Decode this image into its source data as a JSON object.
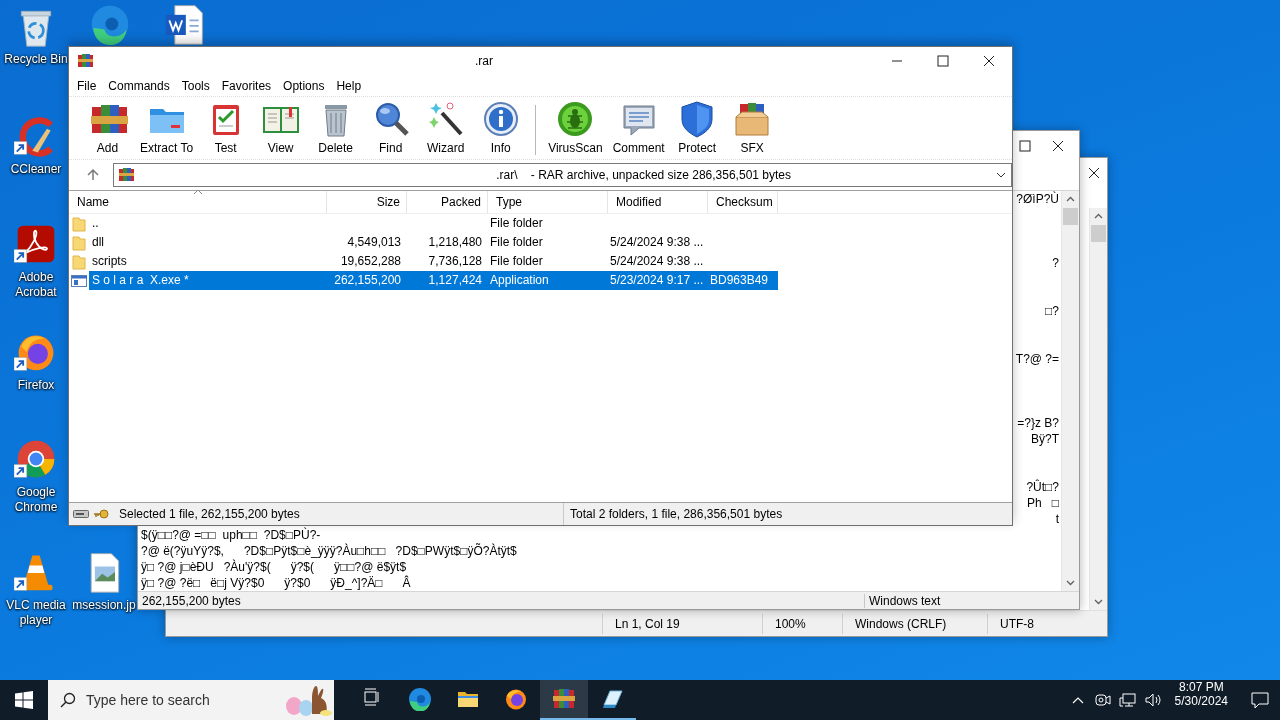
{
  "desktop_icons": [
    {
      "kind": "recycle",
      "label": "Recycle Bin",
      "shortcut": false
    },
    {
      "kind": "edge",
      "shortcut": false
    },
    {
      "kind": "word",
      "shortcut": false
    },
    {
      "kind": "ccleaner",
      "label": "CCleaner",
      "shortcut": true
    },
    {
      "kind": "acrobat",
      "label": "Adobe Acrobat",
      "shortcut": true
    },
    {
      "kind": "firefox",
      "label": "Firefox",
      "shortcut": true
    },
    {
      "kind": "chrome",
      "label": "Google Chrome",
      "shortcut": true
    },
    {
      "kind": "vlc",
      "label": "VLC media player",
      "shortcut": true
    },
    {
      "kind": "image",
      "label": "msession.jp",
      "shortcut": false
    }
  ],
  "notepad_window": {
    "status_bar": [
      "Ln 1, Col 19",
      "100%",
      "Windows (CRLF)",
      "UTF-8"
    ]
  },
  "viewer_window": {
    "lines": [
      {
        "kind": "tail",
        "text": "?ØìP?Ù"
      },
      {
        "kind": "blank"
      },
      {
        "kind": "blank"
      },
      {
        "kind": "blank"
      },
      {
        "kind": "tail",
        "text": "?"
      },
      {
        "kind": "blank"
      },
      {
        "kind": "blank"
      },
      {
        "kind": "tail",
        "text": "□?"
      },
      {
        "kind": "blank"
      },
      {
        "kind": "blank"
      },
      {
        "kind": "tail",
        "text": "T?@ ?="
      },
      {
        "kind": "blank"
      },
      {
        "kind": "blank"
      },
      {
        "kind": "blank"
      },
      {
        "kind": "tail",
        "text": "=?}z B?"
      },
      {
        "kind": "tail",
        "text": "Bÿ?T"
      },
      {
        "kind": "blank"
      },
      {
        "kind": "blank"
      },
      {
        "kind": "tail",
        "text": "?Ût□?"
      },
      {
        "kind": "tail",
        "text": "Ph   □"
      },
      {
        "kind": "tail",
        "text": "t"
      },
      {
        "kind": "full",
        "text": "$(ÿ□□?@ =□□  uph□□  ?D$□PÙ?-"
      },
      {
        "kind": "full",
        "text": "?@ ë(?ÿuYÿ?$,      ?D$□Pÿt$□è_ÿÿÿ?Àu□h□□   ?D$□PWÿt$□ÿÕ?Àtÿt$"
      },
      {
        "kind": "full",
        "text": "ÿ□ ?@ j□èÐU   ?Àu'ÿ?$(      ÿ?$(      ÿ□□?@ ë$ÿt$"
      },
      {
        "kind": "full",
        "text": "ÿ□ ?@ ?ë□   ë□j Vÿ?$0      ÿ?$0      ÿÐ_^]?Ä□      Â"
      }
    ],
    "status_bar": [
      "262,155,200 bytes",
      "Windows text"
    ]
  },
  "winrar": {
    "title": ".rar",
    "menu": [
      "File",
      "Commands",
      "Tools",
      "Favorites",
      "Options",
      "Help"
    ],
    "toolbar": [
      {
        "kind": "add",
        "label": "Add"
      },
      {
        "kind": "extract",
        "label": "Extract To"
      },
      {
        "kind": "test",
        "label": "Test"
      },
      {
        "kind": "view",
        "label": "View"
      },
      {
        "kind": "delete",
        "label": "Delete"
      },
      {
        "kind": "find",
        "label": "Find"
      },
      {
        "kind": "wizard",
        "label": "Wizard"
      },
      {
        "kind": "info",
        "label": "Info"
      },
      {
        "kind": "separator"
      },
      {
        "kind": "virusscan",
        "label": "VirusScan"
      },
      {
        "kind": "comment",
        "label": "Comment"
      },
      {
        "kind": "protect",
        "label": "Protect"
      },
      {
        "kind": "sfx",
        "label": "SFX"
      }
    ],
    "address": ".rar\\    - RAR archive, unpacked size 286,356,501 bytes",
    "columns": [
      {
        "label": "Name",
        "sorted": true
      },
      {
        "label": "Size",
        "sorted": false
      },
      {
        "label": "Packed",
        "sorted": false
      },
      {
        "label": "Type",
        "sorted": false
      },
      {
        "label": "Modified",
        "sorted": false
      },
      {
        "label": "Checksum",
        "sorted": false
      }
    ],
    "rows": [
      {
        "kind": "folder",
        "name": "..",
        "type": "File folder",
        "selected": false
      },
      {
        "kind": "folder",
        "name": "dll",
        "size": "4,549,013",
        "packed": "1,218,480",
        "type": "File folder",
        "modified": "5/24/2024 9:38 ...",
        "selected": false
      },
      {
        "kind": "folder",
        "name": "scripts",
        "size": "19,652,288",
        "packed": "7,736,128",
        "type": "File folder",
        "modified": "5/24/2024 9:38 ...",
        "selected": false
      },
      {
        "kind": "application",
        "name": "S o l a r a  X.exe *",
        "size": "262,155,200",
        "packed": "1,127,424",
        "type": "Application",
        "modified": "5/23/2024 9:17 ...",
        "checksum": "BD963B49",
        "selected": true
      }
    ],
    "status_bar": [
      "Selected 1 file, 262,155,200 bytes",
      "Total 2 folders, 1 file, 286,356,501 bytes"
    ]
  },
  "taskbar": {
    "search_placeholder": "Type here to search",
    "apps": [
      {
        "kind": "taskview",
        "selected": false,
        "running": false
      },
      {
        "kind": "edge",
        "selected": false,
        "running": false
      },
      {
        "kind": "explorer",
        "selected": false,
        "running": false
      },
      {
        "kind": "firefox",
        "selected": false,
        "running": false
      },
      {
        "kind": "winrar",
        "selected": true,
        "running": true
      },
      {
        "kind": "notepad",
        "selected": false,
        "running": true
      }
    ],
    "time": "8:07 PM",
    "date": "5/30/2024"
  }
}
